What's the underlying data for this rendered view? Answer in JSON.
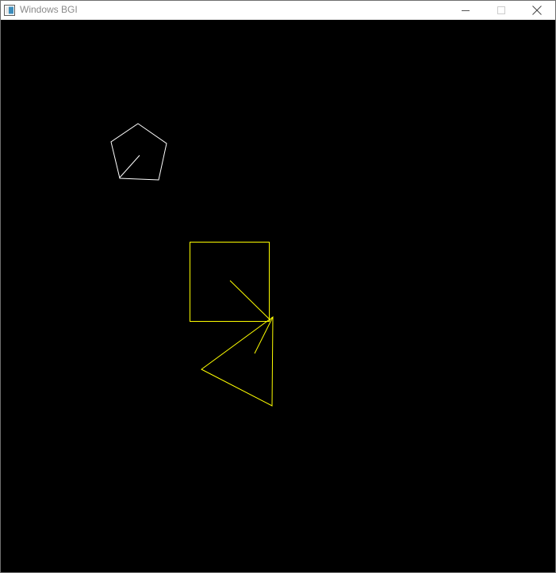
{
  "window": {
    "title": "Windows BGI"
  },
  "titlebar": {
    "buttons": [
      {
        "name": "minimize",
        "icon": "minimize-icon"
      },
      {
        "name": "maximize",
        "icon": "maximize-icon",
        "state": "disabled"
      },
      {
        "name": "close",
        "icon": "close-icon"
      }
    ]
  },
  "canvas": {
    "background": "#000000",
    "shapes": [
      {
        "type": "pentagon",
        "stroke": "#ffffff",
        "has_radius_line": true
      },
      {
        "type": "square",
        "stroke": "#ffff00",
        "has_radius_line": true
      },
      {
        "type": "triangle",
        "stroke": "#ffff00",
        "has_radius_line": true
      }
    ]
  }
}
